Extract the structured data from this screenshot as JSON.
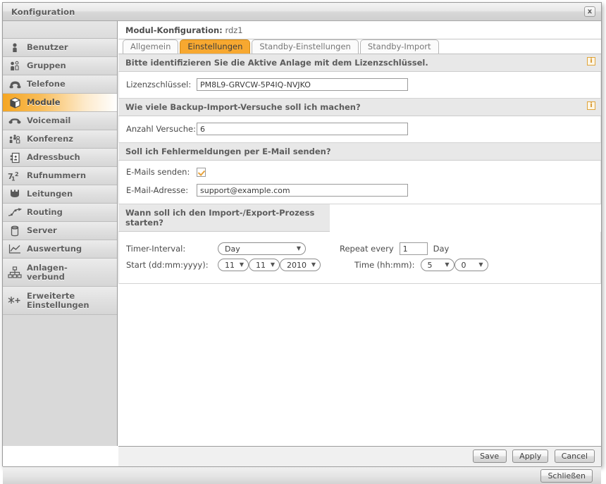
{
  "window": {
    "title": "Konfiguration",
    "close_label": "x"
  },
  "sidebar": {
    "items": [
      {
        "label": "Benutzer",
        "icon": "user-icon",
        "active": false
      },
      {
        "label": "Gruppen",
        "icon": "group-icon",
        "active": false
      },
      {
        "label": "Telefone",
        "icon": "phone-icon",
        "active": false
      },
      {
        "label": "Module",
        "icon": "box-icon",
        "active": true
      },
      {
        "label": "Voicemail",
        "icon": "headset-icon",
        "active": false
      },
      {
        "label": "Konferenz",
        "icon": "conference-icon",
        "active": false
      },
      {
        "label": "Adressbuch",
        "icon": "addressbook-icon",
        "active": false
      },
      {
        "label": "Rufnummern",
        "icon": "numbers-icon",
        "active": false
      },
      {
        "label": "Leitungen",
        "icon": "lines-icon",
        "active": false
      },
      {
        "label": "Routing",
        "icon": "routing-icon",
        "active": false
      },
      {
        "label": "Server",
        "icon": "server-icon",
        "active": false
      },
      {
        "label": "Auswertung",
        "icon": "chart-icon",
        "active": false
      },
      {
        "label": "Anlagen-\nverbund",
        "icon": "network-icon",
        "active": false
      },
      {
        "label": "Erweiterte\nEinstellungen",
        "icon": "advanced-icon",
        "active": false
      }
    ]
  },
  "content": {
    "header_label": "Modul-Konfiguration:",
    "module_name": "rdz1",
    "tabs": [
      {
        "label": "Allgemein",
        "active": false
      },
      {
        "label": "Einstellungen",
        "active": true
      },
      {
        "label": "Standby-Einstellungen",
        "active": false
      },
      {
        "label": "Standby-Import",
        "active": false
      }
    ],
    "sections": {
      "license": {
        "heading": "Bitte identifizieren Sie die Aktive Anlage mit dem Lizenzschlüssel.",
        "info_label": "i",
        "field_label": "Lizenzschlüssel:",
        "field_value": "PM8L9-GRVCW-5P4IQ-NVJKO"
      },
      "attempts": {
        "heading": "Wie viele Backup-Import-Versuche soll ich machen?",
        "info_label": "i",
        "field_label": "Anzahl Versuche:",
        "field_value": "6"
      },
      "email": {
        "heading": "Soll ich Fehlermeldungen per E-Mail senden?",
        "checkbox_label": "E-Mails senden:",
        "checkbox_checked": true,
        "address_label": "E-Mail-Adresse:",
        "address_value": "support@example.com"
      },
      "schedule": {
        "heading": "Wann soll ich den Import-/Export-Prozess starten?",
        "interval_label": "Timer-Interval:",
        "interval_value": "Day",
        "repeat_prefix": "Repeat every",
        "repeat_value": "1",
        "repeat_suffix": "Day",
        "start_label": "Start (dd:mm:yyyy):",
        "start_day": "11",
        "start_month": "11",
        "start_year": "2010",
        "time_label": "Time (hh:mm):",
        "time_hour": "5",
        "time_minute": "0"
      }
    }
  },
  "actions": {
    "save": "Save",
    "apply": "Apply",
    "cancel": "Cancel",
    "close": "Schließen"
  },
  "colors": {
    "accent": "#f7a830",
    "accent_border": "#d08a18",
    "sidebar_bg": "#d9d9d9",
    "section_head_bg": "#e8e8e8"
  }
}
